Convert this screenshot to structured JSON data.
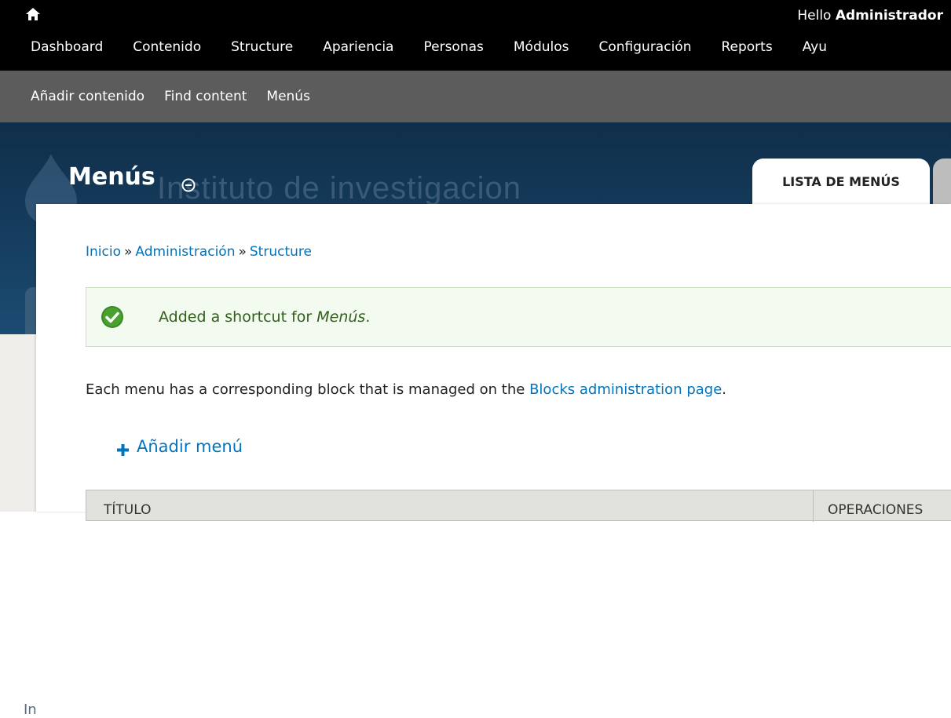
{
  "topbar": {
    "greeting_prefix": "Hello",
    "user_name": "Administrador",
    "menu": [
      "Dashboard",
      "Contenido",
      "Structure",
      "Apariencia",
      "Personas",
      "Módulos",
      "Configuración",
      "Reports",
      "Ayu"
    ]
  },
  "shortcuts": [
    "Añadir contenido",
    "Find content",
    "Menús"
  ],
  "header": {
    "site_name": "Instituto de investigacion",
    "page_title": "Menús",
    "tab_active": "LISTA DE MENÚS"
  },
  "grey_peek": "In",
  "breadcrumb": [
    "Inicio",
    "Administración",
    "Structure"
  ],
  "breadcrumb_separator": "»",
  "message": {
    "prefix": "Added a shortcut for",
    "emphasis": "Menús",
    "suffix": "."
  },
  "intro": {
    "text_before": "Each menu has a corresponding block that is managed on the",
    "link": "Blocks administration page",
    "text_after": "."
  },
  "add_menu_label": "Añadir menú",
  "table": {
    "columns": [
      "Título",
      "Operaciones"
    ]
  },
  "colors": {
    "link": "#0074bd",
    "topbar": "#000000",
    "shortcut_bar": "#5c5c5c",
    "header": "#1b4b72",
    "message_bg": "#f3faef",
    "message_text": "#325e1c"
  }
}
